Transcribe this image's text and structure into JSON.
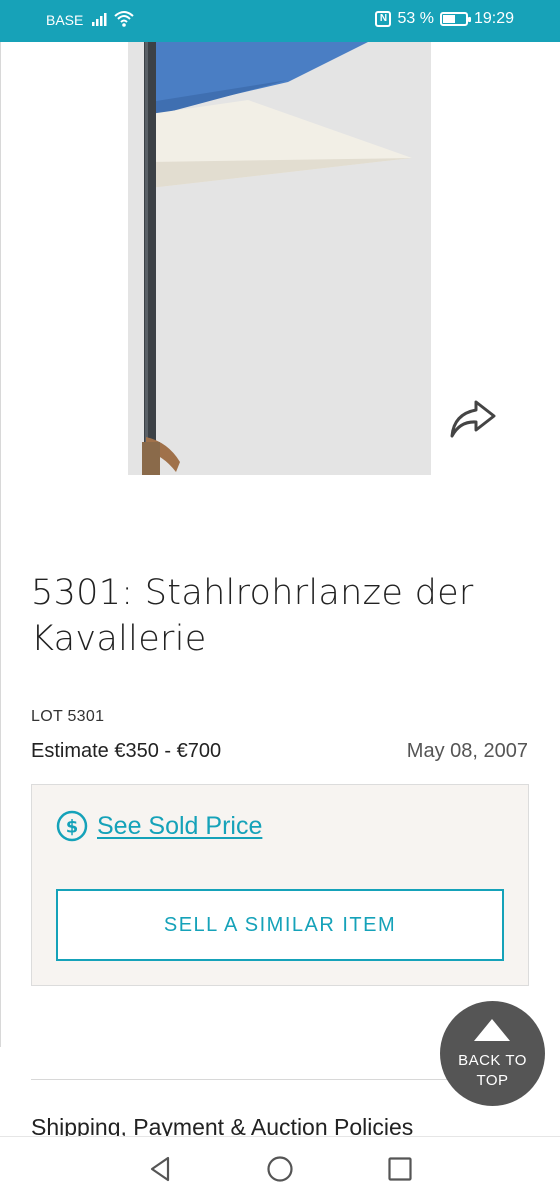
{
  "status_bar": {
    "carrier": "BASE",
    "battery_percent": "53 %",
    "battery_level": 0.53,
    "time": "19:29",
    "icons": [
      "signal-icon",
      "wifi-icon",
      "nfc-icon",
      "battery-icon"
    ]
  },
  "hero_image": {
    "subject": "lance-pennant-image",
    "pennant_colors": [
      "#4a7ec4",
      "#f2efe6"
    ]
  },
  "lot": {
    "title": "5301: Stahlrohrlanze der Kavallerie",
    "lot_number": "LOT 5301",
    "estimate": "Estimate €350 - €700",
    "date": "May 08, 2007"
  },
  "sold_panel": {
    "see_sold_price": "See Sold Price",
    "sell_similar": "SELL A SIMILAR ITEM",
    "accent_color": "#15a2b9"
  },
  "back_to_top": "BACK TO\nTOP",
  "policies_heading": "Shipping, Payment & Auction Policies",
  "nav_bar": {
    "icons": [
      "back-icon",
      "home-icon",
      "recents-icon"
    ]
  }
}
